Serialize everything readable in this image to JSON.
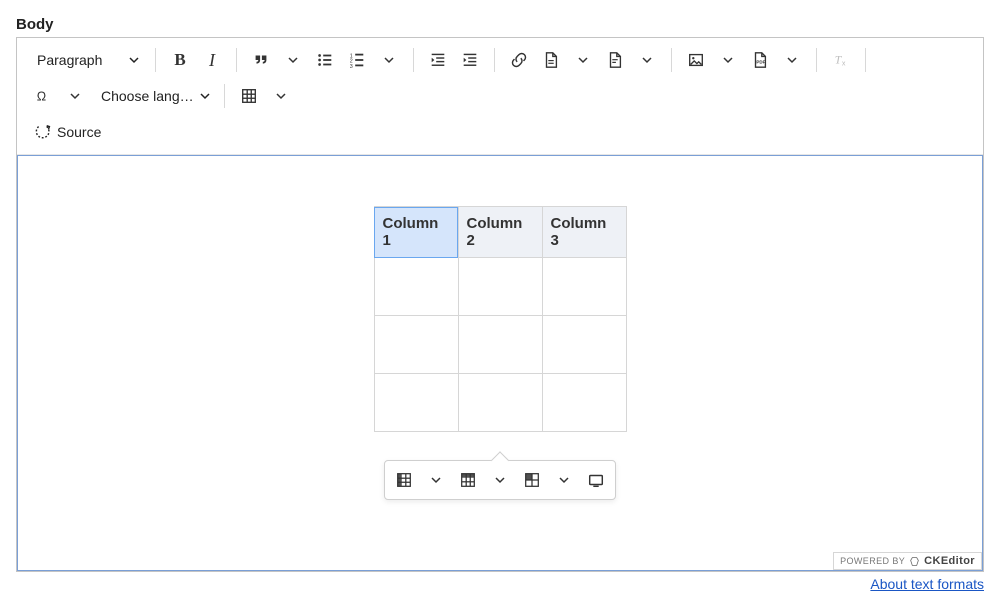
{
  "field_label": "Body",
  "toolbar": {
    "paragraph_label": "Paragraph",
    "source_label": "Source",
    "language_label": "Choose lang…"
  },
  "table": {
    "headers": [
      "Column 1",
      "Column 2",
      "Column 3"
    ],
    "rows": [
      [
        "",
        "",
        ""
      ],
      [
        "",
        "",
        ""
      ],
      [
        "",
        "",
        ""
      ]
    ],
    "selected_header_index": 0
  },
  "powered": {
    "prefix": "POWERED BY",
    "brand": "CKEditor"
  },
  "footer": {
    "about_link": "About text formats"
  }
}
